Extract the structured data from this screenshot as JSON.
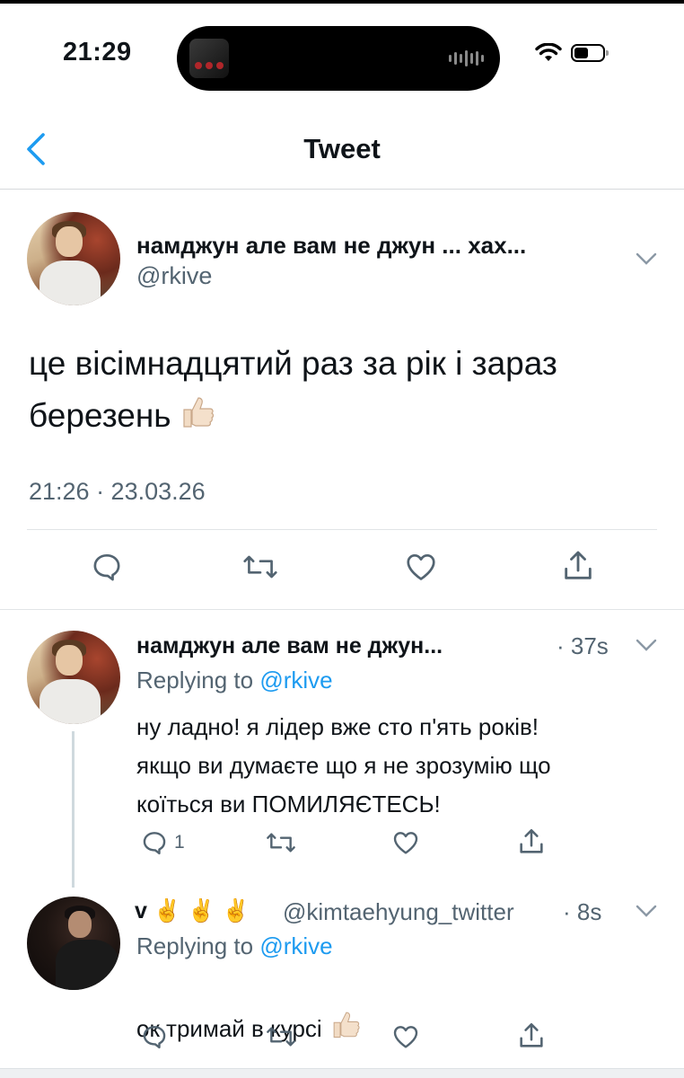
{
  "status_bar": {
    "time": "21:29"
  },
  "header": {
    "title": "Tweet"
  },
  "main_tweet": {
    "name": "намджун але вам не джун ... хах...",
    "handle": "@rkive",
    "text": "це вісімнадцятий раз за рік і зараз\nберезень",
    "timestamp": "21:26 · 23.03.26"
  },
  "replies": [
    {
      "name": "намджун але вам не джун...",
      "age": "· 37s",
      "replying_prefix": "Replying to",
      "replying_handle": "@rkive",
      "text": "ну ладно! я лідер вже сто п'ять років!\nякщо ви думаєте що я не зрозумію що\nкоїться ви ПОМИЛЯЄТЕСЬ!",
      "reply_count": "1"
    },
    {
      "name": "v ✌️ ✌️ ✌️",
      "handle": "@kimtaehyung_twitter",
      "age": "· 8s",
      "replying_prefix": "Replying to",
      "replying_handle": "@rkive",
      "text": "ок тримай в курсі"
    }
  ],
  "icons": {
    "back": "chevron-left-icon",
    "reply": "comment-icon",
    "retweet": "retweet-icon",
    "like": "heart-icon",
    "share": "share-icon",
    "more": "chevron-down-icon",
    "thumbs": "thumbs-up-icon"
  },
  "colors": {
    "accent": "#1d9bf0",
    "muted": "#536471",
    "text": "#0f1419"
  }
}
